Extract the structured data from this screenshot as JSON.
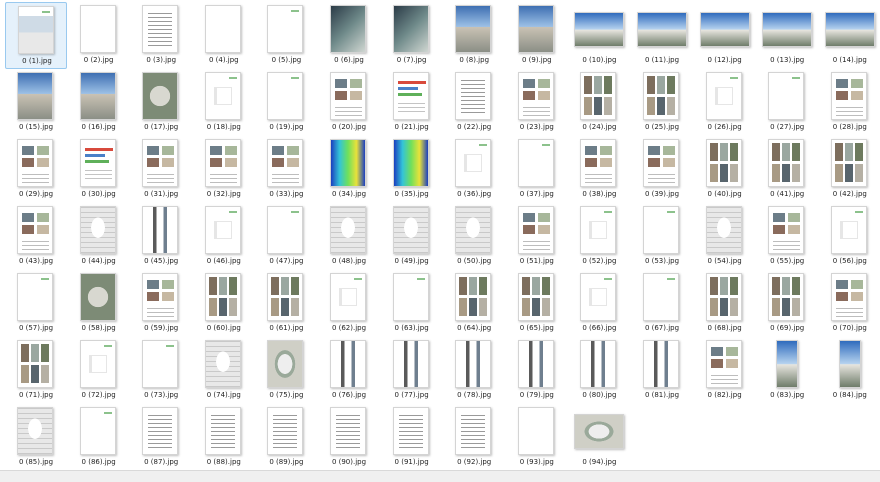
{
  "files": [
    {
      "name": "0 (1).jpg",
      "kind": "pale",
      "selected": true
    },
    {
      "name": "0 (2).jpg",
      "kind": "blank"
    },
    {
      "name": "0 (3).jpg",
      "kind": "text"
    },
    {
      "name": "0 (4).jpg",
      "kind": "blank"
    },
    {
      "name": "0 (5).jpg",
      "kind": "green"
    },
    {
      "name": "0 (6).jpg",
      "kind": "dark"
    },
    {
      "name": "0 (7).jpg",
      "kind": "dark"
    },
    {
      "name": "0 (8).jpg",
      "kind": "sky"
    },
    {
      "name": "0 (9).jpg",
      "kind": "sky"
    },
    {
      "name": "0 (10).jpg",
      "kind": "sky2",
      "shape": "land"
    },
    {
      "name": "0 (11).jpg",
      "kind": "sky2",
      "shape": "land"
    },
    {
      "name": "0 (12).jpg",
      "kind": "sky2",
      "shape": "land"
    },
    {
      "name": "0 (13).jpg",
      "kind": "sky2",
      "shape": "land"
    },
    {
      "name": "0 (14).jpg",
      "kind": "sky2",
      "shape": "land"
    },
    {
      "name": "0 (15).jpg",
      "kind": "sky"
    },
    {
      "name": "0 (16).jpg",
      "kind": "sky"
    },
    {
      "name": "0 (17).jpg",
      "kind": "aerial"
    },
    {
      "name": "0 (18).jpg",
      "kind": "glyph"
    },
    {
      "name": "0 (19).jpg",
      "kind": "green"
    },
    {
      "name": "0 (20).jpg",
      "kind": "mix"
    },
    {
      "name": "0 (21).jpg",
      "kind": "chart"
    },
    {
      "name": "0 (22).jpg",
      "kind": "text"
    },
    {
      "name": "0 (23).jpg",
      "kind": "mix"
    },
    {
      "name": "0 (24).jpg",
      "kind": "photogrid"
    },
    {
      "name": "0 (25).jpg",
      "kind": "photogrid"
    },
    {
      "name": "0 (26).jpg",
      "kind": "glyph"
    },
    {
      "name": "0 (27).jpg",
      "kind": "green"
    },
    {
      "name": "0 (28).jpg",
      "kind": "mix"
    },
    {
      "name": "0 (29).jpg",
      "kind": "mix"
    },
    {
      "name": "0 (30).jpg",
      "kind": "chart"
    },
    {
      "name": "0 (31).jpg",
      "kind": "mix"
    },
    {
      "name": "0 (32).jpg",
      "kind": "mix"
    },
    {
      "name": "0 (33).jpg",
      "kind": "mix"
    },
    {
      "name": "0 (34).jpg",
      "kind": "heat"
    },
    {
      "name": "0 (35).jpg",
      "kind": "heat"
    },
    {
      "name": "0 (36).jpg",
      "kind": "glyph"
    },
    {
      "name": "0 (37).jpg",
      "kind": "green"
    },
    {
      "name": "0 (38).jpg",
      "kind": "mix"
    },
    {
      "name": "0 (39).jpg",
      "kind": "mix"
    },
    {
      "name": "0 (40).jpg",
      "kind": "photogrid"
    },
    {
      "name": "0 (41).jpg",
      "kind": "photogrid"
    },
    {
      "name": "0 (42).jpg",
      "kind": "photogrid"
    },
    {
      "name": "0 (43).jpg",
      "kind": "mix"
    },
    {
      "name": "0 (44).jpg",
      "kind": "plan"
    },
    {
      "name": "0 (45).jpg",
      "kind": "strip"
    },
    {
      "name": "0 (46).jpg",
      "kind": "glyph"
    },
    {
      "name": "0 (47).jpg",
      "kind": "green"
    },
    {
      "name": "0 (48).jpg",
      "kind": "plan"
    },
    {
      "name": "0 (49).jpg",
      "kind": "plan"
    },
    {
      "name": "0 (50).jpg",
      "kind": "plan"
    },
    {
      "name": "0 (51).jpg",
      "kind": "mix"
    },
    {
      "name": "0 (52).jpg",
      "kind": "glyph"
    },
    {
      "name": "0 (53).jpg",
      "kind": "green"
    },
    {
      "name": "0 (54).jpg",
      "kind": "plan"
    },
    {
      "name": "0 (55).jpg",
      "kind": "mix"
    },
    {
      "name": "0 (56).jpg",
      "kind": "glyph"
    },
    {
      "name": "0 (57).jpg",
      "kind": "green"
    },
    {
      "name": "0 (58).jpg",
      "kind": "aerial"
    },
    {
      "name": "0 (59).jpg",
      "kind": "mix"
    },
    {
      "name": "0 (60).jpg",
      "kind": "photogrid"
    },
    {
      "name": "0 (61).jpg",
      "kind": "photogrid"
    },
    {
      "name": "0 (62).jpg",
      "kind": "glyph"
    },
    {
      "name": "0 (63).jpg",
      "kind": "green"
    },
    {
      "name": "0 (64).jpg",
      "kind": "photogrid"
    },
    {
      "name": "0 (65).jpg",
      "kind": "photogrid"
    },
    {
      "name": "0 (66).jpg",
      "kind": "glyph"
    },
    {
      "name": "0 (67).jpg",
      "kind": "green"
    },
    {
      "name": "0 (68).jpg",
      "kind": "photogrid"
    },
    {
      "name": "0 (69).jpg",
      "kind": "photogrid"
    },
    {
      "name": "0 (70).jpg",
      "kind": "mix"
    },
    {
      "name": "0 (71).jpg",
      "kind": "photogrid"
    },
    {
      "name": "0 (72).jpg",
      "kind": "glyph"
    },
    {
      "name": "0 (73).jpg",
      "kind": "green"
    },
    {
      "name": "0 (74).jpg",
      "kind": "plan"
    },
    {
      "name": "0 (75).jpg",
      "kind": "site"
    },
    {
      "name": "0 (76).jpg",
      "kind": "strip"
    },
    {
      "name": "0 (77).jpg",
      "kind": "strip"
    },
    {
      "name": "0 (78).jpg",
      "kind": "strip"
    },
    {
      "name": "0 (79).jpg",
      "kind": "strip"
    },
    {
      "name": "0 (80).jpg",
      "kind": "strip"
    },
    {
      "name": "0 (81).jpg",
      "kind": "strip"
    },
    {
      "name": "0 (82).jpg",
      "kind": "mix"
    },
    {
      "name": "0 (83).jpg",
      "kind": "sky2",
      "shape": "tall"
    },
    {
      "name": "0 (84).jpg",
      "kind": "sky2",
      "shape": "tall"
    },
    {
      "name": "0 (85).jpg",
      "kind": "plan"
    },
    {
      "name": "0 (86).jpg",
      "kind": "green"
    },
    {
      "name": "0 (87).jpg",
      "kind": "text"
    },
    {
      "name": "0 (88).jpg",
      "kind": "text"
    },
    {
      "name": "0 (89).jpg",
      "kind": "text"
    },
    {
      "name": "0 (90).jpg",
      "kind": "text"
    },
    {
      "name": "0 (91).jpg",
      "kind": "text"
    },
    {
      "name": "0 (92).jpg",
      "kind": "text"
    },
    {
      "name": "0 (93).jpg",
      "kind": "blank"
    },
    {
      "name": "0 (94).jpg",
      "kind": "site",
      "shape": "land"
    }
  ]
}
